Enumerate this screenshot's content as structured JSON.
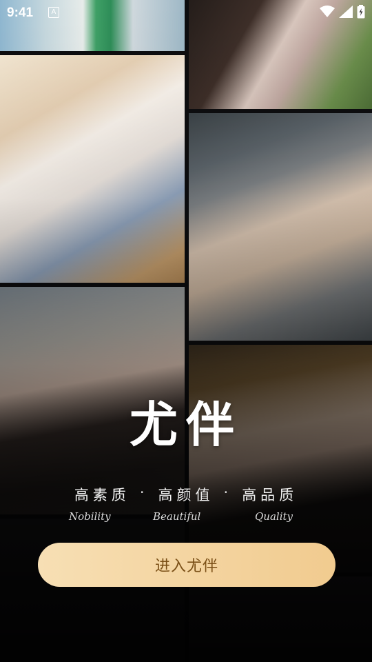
{
  "status_bar": {
    "time": "9:41",
    "notification": "A",
    "icons": [
      "wifi-icon",
      "signal-icon",
      "battery-icon"
    ]
  },
  "brand": {
    "name": "尤伴"
  },
  "slogans": [
    "高素质",
    "高颜值",
    "高品质"
  ],
  "slogan_separator": "·",
  "subtitles": [
    "Nobility",
    "Beautiful",
    "Quality"
  ],
  "enter_button": {
    "label": "进入尤伴"
  },
  "colors": {
    "button_gradient_start": "#f7dfb4",
    "button_gradient_end": "#f1cb8f",
    "button_text": "#7a4f16"
  }
}
